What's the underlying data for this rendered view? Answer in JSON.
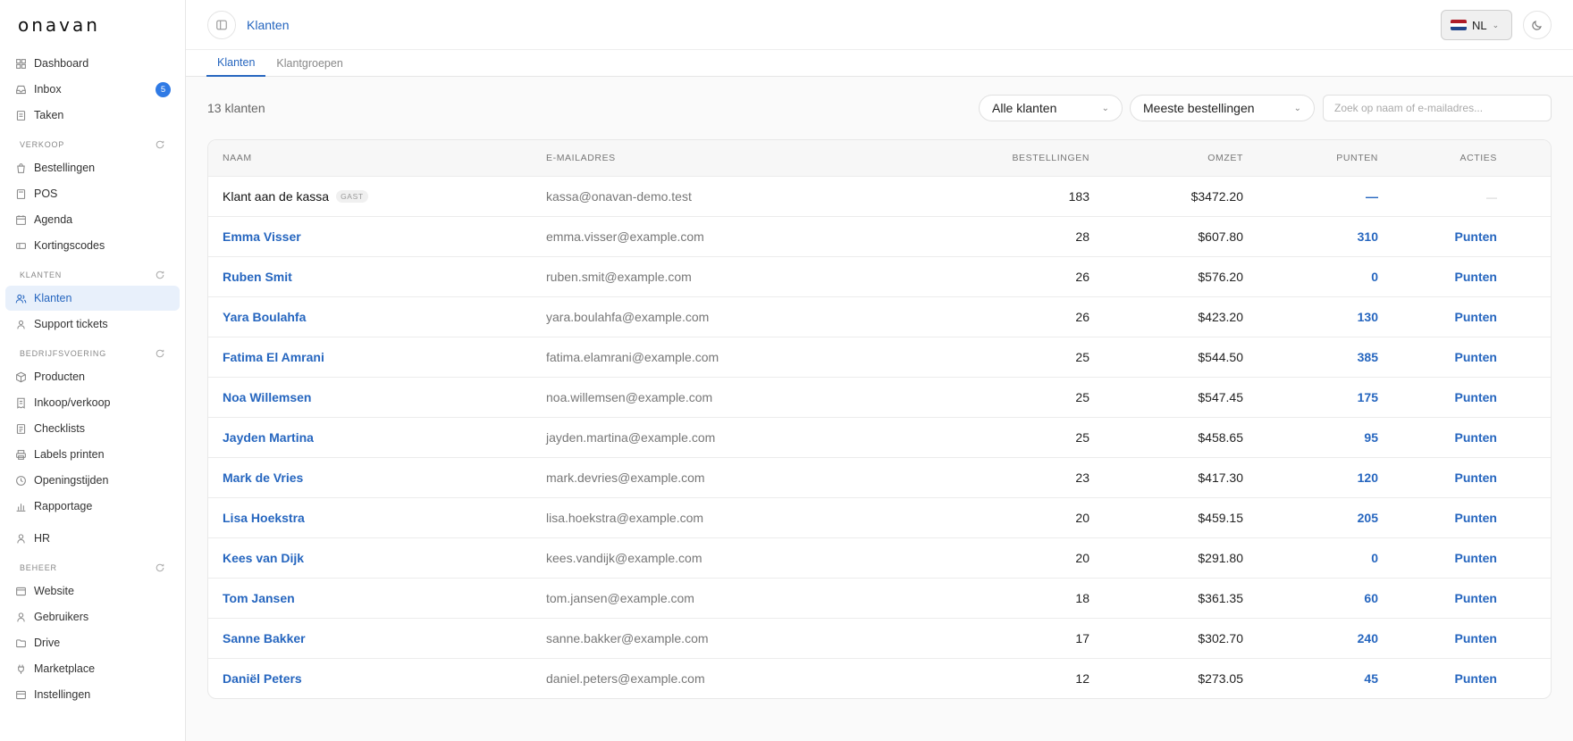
{
  "brand": {
    "logo": "onavan"
  },
  "sidebar": {
    "main": [
      {
        "label": "Dashboard",
        "icon": "grid-icon"
      },
      {
        "label": "Inbox",
        "icon": "inbox-icon",
        "badge": "5"
      },
      {
        "label": "Taken",
        "icon": "tasks-icon"
      }
    ],
    "sections": [
      {
        "title": "VERKOOP",
        "items": [
          {
            "label": "Bestellingen",
            "icon": "bag-icon"
          },
          {
            "label": "POS",
            "icon": "pos-icon"
          },
          {
            "label": "Agenda",
            "icon": "calendar-icon"
          },
          {
            "label": "Kortingscodes",
            "icon": "ticket-icon"
          }
        ]
      },
      {
        "title": "KLANTEN",
        "items": [
          {
            "label": "Klanten",
            "icon": "users-icon",
            "active": true
          },
          {
            "label": "Support tickets",
            "icon": "support-icon"
          }
        ]
      },
      {
        "title": "BEDRIJFSVOERING",
        "items": [
          {
            "label": "Producten",
            "icon": "box-icon"
          },
          {
            "label": "Inkoop/verkoop",
            "icon": "receipt-icon"
          },
          {
            "label": "Checklists",
            "icon": "checklist-icon"
          },
          {
            "label": "Labels printen",
            "icon": "printer-icon"
          },
          {
            "label": "Openingstijden",
            "icon": "clock-icon"
          },
          {
            "label": "Rapportage",
            "icon": "chart-icon"
          }
        ]
      },
      {
        "title": "",
        "items": [
          {
            "label": "HR",
            "icon": "person-icon"
          }
        ]
      },
      {
        "title": "BEHEER",
        "items": [
          {
            "label": "Website",
            "icon": "browser-icon"
          },
          {
            "label": "Gebruikers",
            "icon": "user-icon"
          },
          {
            "label": "Drive",
            "icon": "folder-icon"
          },
          {
            "label": "Marketplace",
            "icon": "plug-icon"
          },
          {
            "label": "Instellingen",
            "icon": "settings-icon"
          }
        ]
      }
    ]
  },
  "header": {
    "breadcrumb": "Klanten",
    "language": "NL",
    "flag_colors": [
      "#ae1c28",
      "#ffffff",
      "#21468b"
    ]
  },
  "tabs": [
    {
      "label": "Klanten",
      "active": true
    },
    {
      "label": "Klantgroepen",
      "active": false
    }
  ],
  "toolbar": {
    "count": "13 klanten",
    "filter_value": "Alle klanten",
    "sort_value": "Meeste bestellingen",
    "search_placeholder": "Zoek op naam of e-mailadres..."
  },
  "table": {
    "columns": [
      "NAAM",
      "E-MAILADRES",
      "BESTELLINGEN",
      "OMZET",
      "PUNTEN",
      "ACTIES"
    ],
    "rows": [
      {
        "name": "Klant aan de kassa",
        "tag": "GAST",
        "email": "kassa@onavan-demo.test",
        "orders": "183",
        "omzet": "$3472.20",
        "punten": "—",
        "actie": "—",
        "guest": true
      },
      {
        "name": "Emma Visser",
        "email": "emma.visser@example.com",
        "orders": "28",
        "omzet": "$607.80",
        "punten": "310",
        "actie": "Punten"
      },
      {
        "name": "Ruben Smit",
        "email": "ruben.smit@example.com",
        "orders": "26",
        "omzet": "$576.20",
        "punten": "0",
        "actie": "Punten"
      },
      {
        "name": "Yara Boulahfa",
        "email": "yara.boulahfa@example.com",
        "orders": "26",
        "omzet": "$423.20",
        "punten": "130",
        "actie": "Punten"
      },
      {
        "name": "Fatima El Amrani",
        "email": "fatima.elamrani@example.com",
        "orders": "25",
        "omzet": "$544.50",
        "punten": "385",
        "actie": "Punten"
      },
      {
        "name": "Noa Willemsen",
        "email": "noa.willemsen@example.com",
        "orders": "25",
        "omzet": "$547.45",
        "punten": "175",
        "actie": "Punten"
      },
      {
        "name": "Jayden Martina",
        "email": "jayden.martina@example.com",
        "orders": "25",
        "omzet": "$458.65",
        "punten": "95",
        "actie": "Punten"
      },
      {
        "name": "Mark de Vries",
        "email": "mark.devries@example.com",
        "orders": "23",
        "omzet": "$417.30",
        "punten": "120",
        "actie": "Punten"
      },
      {
        "name": "Lisa Hoekstra",
        "email": "lisa.hoekstra@example.com",
        "orders": "20",
        "omzet": "$459.15",
        "punten": "205",
        "actie": "Punten"
      },
      {
        "name": "Kees van Dijk",
        "email": "kees.vandijk@example.com",
        "orders": "20",
        "omzet": "$291.80",
        "punten": "0",
        "actie": "Punten"
      },
      {
        "name": "Tom Jansen",
        "email": "tom.jansen@example.com",
        "orders": "18",
        "omzet": "$361.35",
        "punten": "60",
        "actie": "Punten"
      },
      {
        "name": "Sanne Bakker",
        "email": "sanne.bakker@example.com",
        "orders": "17",
        "omzet": "$302.70",
        "punten": "240",
        "actie": "Punten"
      },
      {
        "name": "Daniël Peters",
        "email": "daniel.peters@example.com",
        "orders": "12",
        "omzet": "$273.05",
        "punten": "45",
        "actie": "Punten"
      }
    ]
  },
  "colors": {
    "accent": "#2666bf",
    "badge": "#2f7ae5",
    "active_bg": "#e8f0fb"
  }
}
